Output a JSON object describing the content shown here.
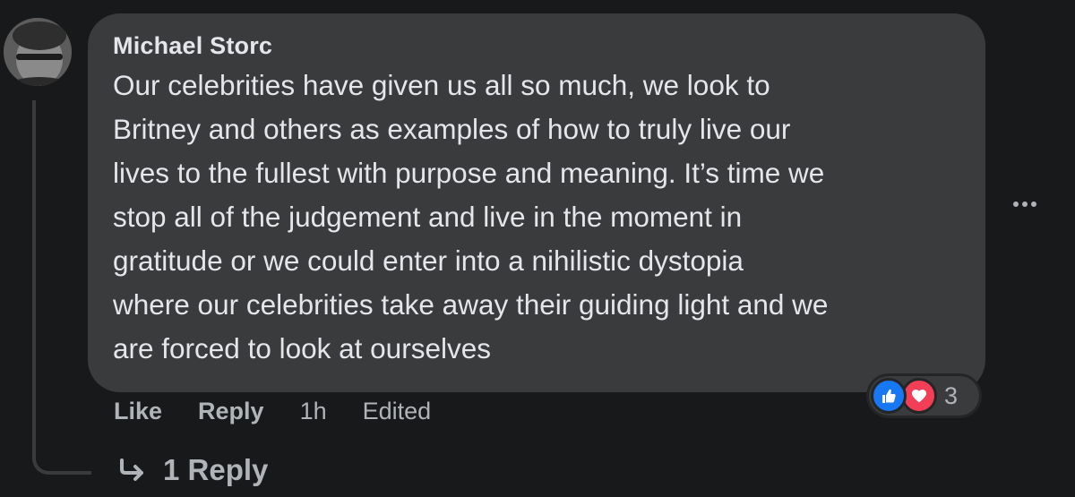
{
  "comment": {
    "author": "Michael Storc",
    "text": "Our celebrities have given us all so much, we look to\nBritney and others as examples of how to truly live our\nlives to the fullest with purpose and meaning. It’s time we\nstop all of the judgement and live in the moment in\ngratitude or we could enter into a nihilistic dystopia\nwhere our celebrities take away their guiding light and we\nare forced to look at ourselves",
    "actions": {
      "like_label": "Like",
      "reply_label": "Reply",
      "timestamp": "1h",
      "edited_label": "Edited"
    },
    "reactions": {
      "icons": [
        "like-icon",
        "love-icon"
      ],
      "count": "3",
      "colors": {
        "like": "#1877f2",
        "love": "#f33e58"
      }
    },
    "replies_link": "1 Reply",
    "more_icon": "more-options-icon"
  }
}
